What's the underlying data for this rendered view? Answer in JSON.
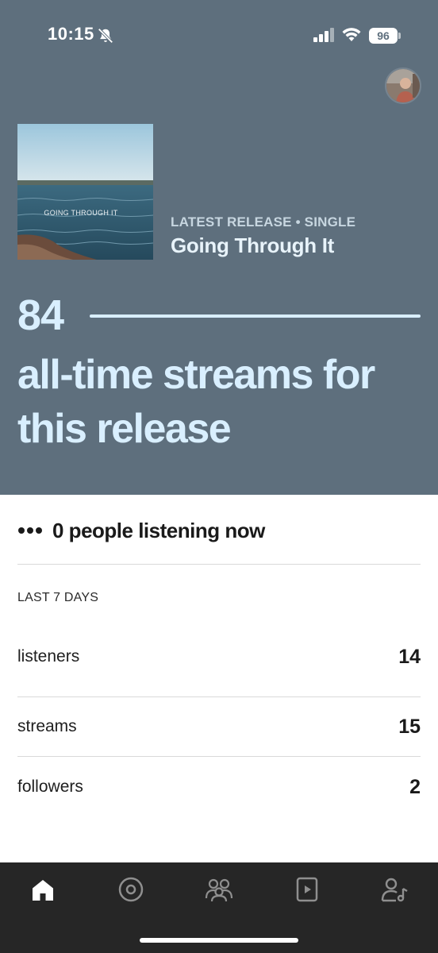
{
  "status_bar": {
    "time": "10:15",
    "battery": "96",
    "icons": [
      "bell-slash-icon",
      "signal-icon",
      "wifi-icon",
      "battery-icon"
    ]
  },
  "header": {
    "avatar": "profile-avatar"
  },
  "release": {
    "cover_text": "GOING THROUGH IT",
    "meta": "LATEST RELEASE • SINGLE",
    "title": "Going Through It"
  },
  "highlight": {
    "number": "84",
    "caption": "all-time streams for this release"
  },
  "live": {
    "icon": "dots-icon",
    "text": "0 people listening now"
  },
  "stats": {
    "section_label": "LAST 7 DAYS",
    "rows": [
      {
        "label": "listeners",
        "value": "14"
      },
      {
        "label": "streams",
        "value": "15"
      },
      {
        "label": "followers",
        "value": "2"
      }
    ]
  },
  "tab_bar": {
    "tabs": [
      "home-icon",
      "music-icon",
      "audience-icon",
      "video-icon",
      "team-icon"
    ],
    "active": "home-icon"
  },
  "colors": {
    "hero_bg": "#5e6f7d",
    "hero_text": "#d9efff",
    "meta_text": "#c7d6e0",
    "tab_bar_bg": "#262626"
  }
}
